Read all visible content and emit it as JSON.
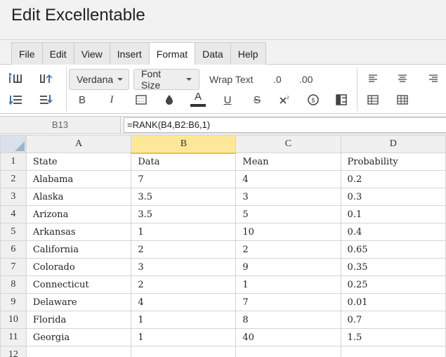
{
  "app": {
    "title": "Edit Excellentable"
  },
  "menu": {
    "tabs": [
      {
        "label": "File"
      },
      {
        "label": "Edit"
      },
      {
        "label": "View"
      },
      {
        "label": "Insert"
      },
      {
        "label": "Format",
        "active": true
      },
      {
        "label": "Data"
      },
      {
        "label": "Help"
      }
    ]
  },
  "toolbar": {
    "font_family": "Verdana",
    "font_size": "Font Size",
    "wrap_text": "Wrap Text",
    "decrease_decimal": ".0",
    "increase_decimal": ".00",
    "bold": "B",
    "italic": "I",
    "underline": "U",
    "strikethrough": "S",
    "font_color": "A",
    "font_color_swatch": "#333333",
    "icons": [
      "insert-row-above-icon",
      "insert-column-icon",
      "insert-row-below-icon",
      "delete-row-icon",
      "border-icon",
      "fill-color-icon",
      "superscript-icon",
      "currency-icon",
      "merge-cells-icon",
      "align-left-icon",
      "align-center-icon",
      "align-right-icon",
      "table-icon",
      "grid-icon"
    ]
  },
  "formula_bar": {
    "cell_ref": "B13",
    "formula": "=RANK(B4,B2:B6,1)"
  },
  "grid": {
    "selected_column": "B",
    "columns": [
      "A",
      "B",
      "C",
      "D"
    ],
    "rows": [
      {
        "num": "1",
        "cells": [
          "State",
          "Data",
          "Mean",
          "Probability"
        ]
      },
      {
        "num": "2",
        "cells": [
          "Alabama",
          "7",
          "4",
          "0.2"
        ]
      },
      {
        "num": "3",
        "cells": [
          "Alaska",
          "3.5",
          "3",
          "0.3"
        ]
      },
      {
        "num": "4",
        "cells": [
          "Arizona",
          "3.5",
          "5",
          "0.1"
        ]
      },
      {
        "num": "5",
        "cells": [
          "Arkansas",
          "1",
          "10",
          "0.4"
        ]
      },
      {
        "num": "6",
        "cells": [
          "California",
          "2",
          "2",
          "0.65"
        ]
      },
      {
        "num": "7",
        "cells": [
          "Colorado",
          "3",
          "9",
          "0.35"
        ]
      },
      {
        "num": "8",
        "cells": [
          "Connecticut",
          "2",
          "1",
          "0.25"
        ]
      },
      {
        "num": "9",
        "cells": [
          "Delaware",
          "4",
          "7",
          "0.01"
        ]
      },
      {
        "num": "10",
        "cells": [
          "Florida",
          "1",
          "8",
          "0.7"
        ]
      },
      {
        "num": "11",
        "cells": [
          "Georgia",
          "1",
          "40",
          "1.5"
        ]
      },
      {
        "num": "12",
        "cells": [
          "",
          "",
          "",
          ""
        ]
      }
    ]
  }
}
